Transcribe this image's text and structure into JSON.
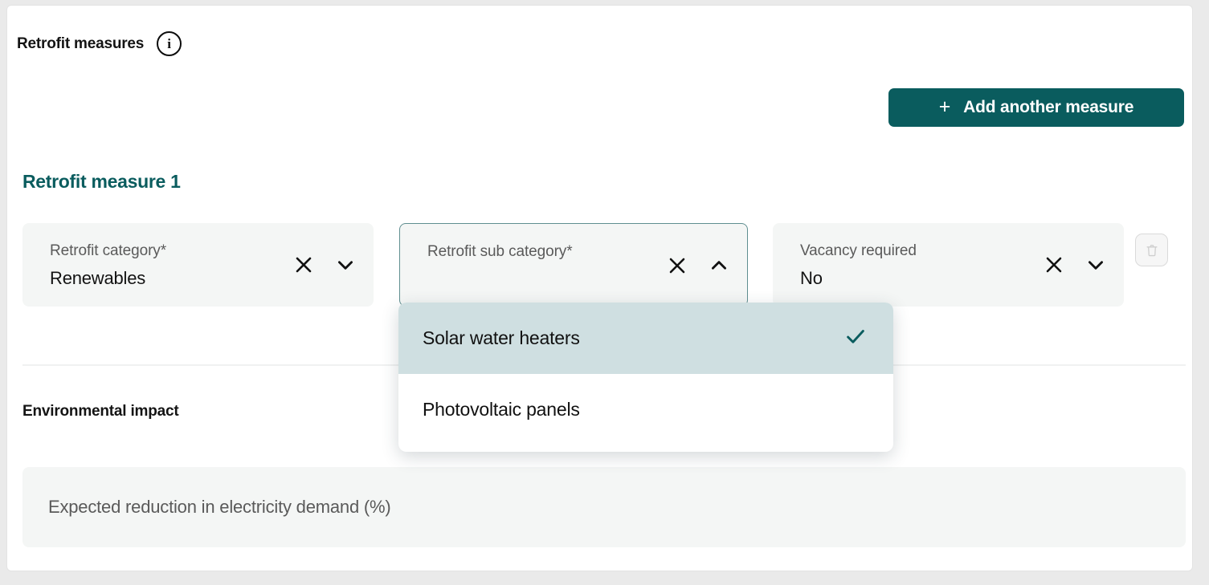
{
  "section": {
    "title": "Retrofit measures",
    "info_icon": "info-icon",
    "info_glyph": "i"
  },
  "toolbar": {
    "add_label": "Add another measure",
    "add_plus": "+"
  },
  "measure": {
    "title": "Retrofit measure 1",
    "fields": [
      {
        "label": "Retrofit category*",
        "value": "Renewables",
        "chevron": "⌄"
      },
      {
        "label": "Retrofit sub category*",
        "value": "",
        "chevron": "⌃"
      },
      {
        "label": "Vacancy required",
        "value": "No",
        "chevron": "⌄"
      }
    ],
    "delete_icon": "trash-icon"
  },
  "dropdown": {
    "options": [
      {
        "label": "Solar water heaters",
        "selected": true
      },
      {
        "label": "Photovoltaic panels",
        "selected": false
      }
    ]
  },
  "environmental": {
    "title": "Environmental impact",
    "input_placeholder": "Expected reduction in electricity demand (%)",
    "input_value": ""
  },
  "colors": {
    "accent_teal": "#0a5c5e",
    "field_bg": "#f4f6f5",
    "highlight": "#cfdfe1",
    "label_gray": "#5a5a5a"
  }
}
